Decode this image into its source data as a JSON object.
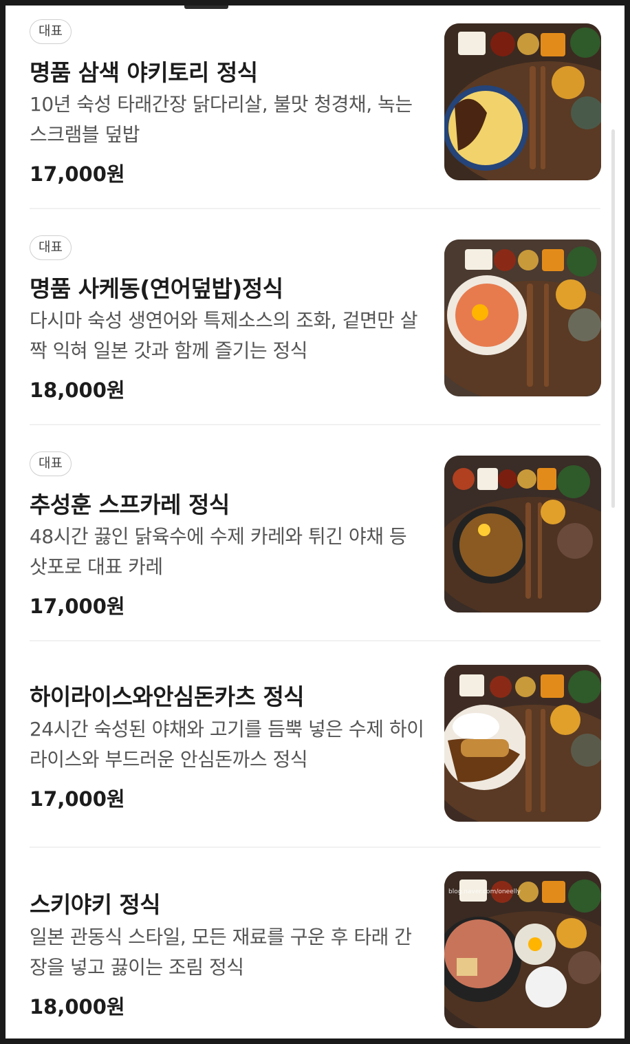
{
  "menu": {
    "items": [
      {
        "badge": "대표",
        "name": "명품 삼색 야키토리 정식",
        "description": "10년 숙성 타래간장 닭다리살, 불맛 청경채, 녹는 스크램블 덮밥",
        "price": "17,000원",
        "image": "yakitori-set-photo"
      },
      {
        "badge": "대표",
        "name": "명품 사케동(연어덮밥)정식",
        "description": "다시마 숙성 생연어와 특제소스의 조화, 겉면만 살짝 익혀 일본 갓과 함께 즐기는 정식",
        "price": "18,000원",
        "image": "sake-don-set-photo"
      },
      {
        "badge": "대표",
        "name": "추성훈 스프카레 정식",
        "description": "48시간 끓인 닭육수에 수제 카레와 튀긴 야채 등 삿포로 대표 카레",
        "price": "17,000원",
        "image": "soup-curry-set-photo"
      },
      {
        "name": "하이라이스와안심돈카츠 정식",
        "description": "24시간 숙성된 야채와 고기를 듬뿍 넣은 수제 하이라이스와 부드러운 안심돈까스 정식",
        "price": "17,000원",
        "image": "hayashi-tonkatsu-set-photo"
      },
      {
        "name": "스키야키 정식",
        "description": "일본 관동식 스타일, 모든 재료를 구운 후 타래 간장을 넣고 끓이는 조림 정식",
        "price": "18,000원",
        "image": "sukiyaki-set-photo",
        "watermark": "blog.naver.com/oneelly"
      }
    ]
  },
  "colors": {
    "background": "#ffffff",
    "text_primary": "#1c1c1c",
    "text_secondary": "#555555",
    "badge_border": "#cfcfcf",
    "divider": "#f1f1f1"
  }
}
